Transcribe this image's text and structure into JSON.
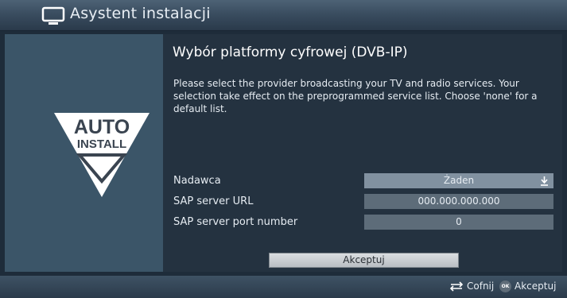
{
  "header": {
    "title": "Asystent instalacji",
    "icon": "tv-icon"
  },
  "logo": {
    "line1": "AUTO",
    "line2": "INSTALL"
  },
  "main": {
    "heading": "Wybór platformy cyfrowej (DVB-IP)",
    "description": "Please select the provider broadcasting your TV and radio services. Your selection take effect on the preprogrammed service list. Choose 'none' for a default list.",
    "fields": [
      {
        "label": "Nadawca",
        "value": "Żaden",
        "icon": "dropdown-arrow-icon"
      },
      {
        "label": "SAP server URL",
        "value": "000.000.000.000"
      },
      {
        "label": "SAP server port number",
        "value": "0"
      }
    ],
    "accept_label": "Akceptuj"
  },
  "footer": {
    "back_label": "Cofnij",
    "ok_badge": "OK",
    "accept_label": "Akceptuj"
  },
  "colors": {
    "header": "#3a4d60",
    "left_panel": "#3b5568",
    "main_panel": "#243240",
    "field_bg": "#5d6c79",
    "field_selected": "#8191a0"
  }
}
